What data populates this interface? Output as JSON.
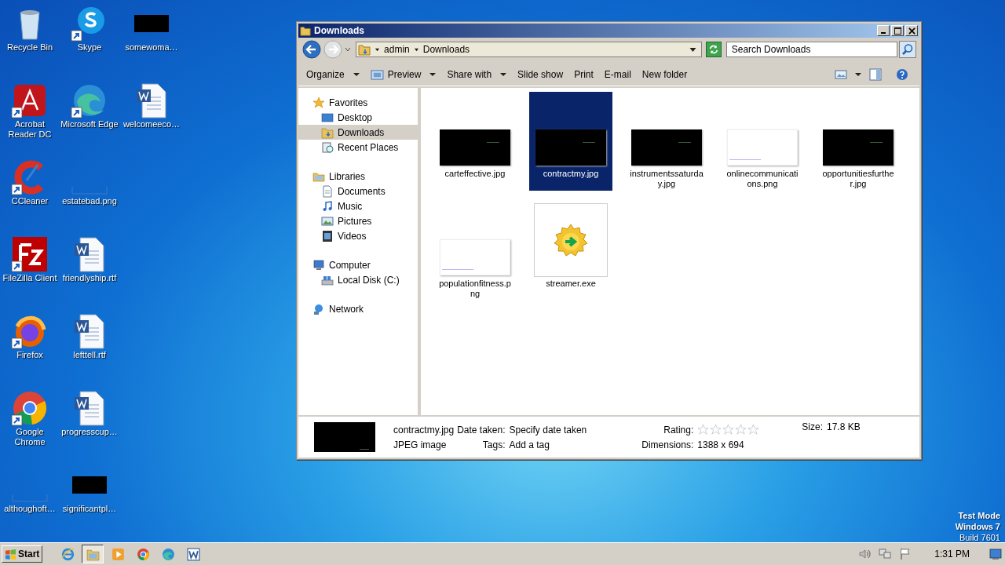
{
  "desktop_icons": [
    [
      {
        "label": "Recycle Bin",
        "kind": "recycle",
        "shortcut": false
      },
      {
        "label": "Skype",
        "kind": "skype",
        "shortcut": true
      },
      {
        "label": "somewoma…",
        "kind": "dark_file"
      }
    ],
    [
      {
        "label": "Acrobat Reader DC",
        "kind": "acrobat",
        "shortcut": true
      },
      {
        "label": "Microsoft Edge",
        "kind": "edge",
        "shortcut": true
      },
      {
        "label": "welcomeeco…",
        "kind": "word",
        "shortcut": false
      }
    ],
    [
      {
        "label": "CCleaner",
        "kind": "ccleaner",
        "shortcut": true
      },
      {
        "label": "estatebad.png",
        "kind": "blank_file"
      }
    ],
    [
      {
        "label": "FileZilla Client",
        "kind": "filezilla",
        "shortcut": true
      },
      {
        "label": "friendlyship.rtf",
        "kind": "word",
        "shortcut": false
      }
    ],
    [
      {
        "label": "Firefox",
        "kind": "firefox",
        "shortcut": true
      },
      {
        "label": "lefttell.rtf",
        "kind": "word",
        "shortcut": false
      }
    ],
    [
      {
        "label": "Google Chrome",
        "kind": "chrome",
        "shortcut": true
      },
      {
        "label": "progresscup…",
        "kind": "word",
        "shortcut": false
      }
    ],
    [
      {
        "label": "althoughoft…",
        "kind": "blank_file"
      },
      {
        "label": "significantpl…",
        "kind": "dark_file"
      }
    ]
  ],
  "window": {
    "title": "Downloads",
    "address": {
      "breadcrumbs": [
        "admin",
        "Downloads"
      ]
    },
    "search": {
      "placeholder": "Search Downloads"
    },
    "toolbar": [
      {
        "label": "Organize",
        "dropdown": true,
        "icon": false
      },
      {
        "label": "Preview",
        "dropdown": true,
        "icon": true
      },
      {
        "label": "Share with",
        "dropdown": true,
        "icon": false
      },
      {
        "label": "Slide show",
        "dropdown": false,
        "icon": false
      },
      {
        "label": "Print",
        "dropdown": false,
        "icon": false
      },
      {
        "label": "E-mail",
        "dropdown": false,
        "icon": false
      },
      {
        "label": "New folder",
        "dropdown": false,
        "icon": false
      }
    ],
    "navigation": [
      {
        "label": "Favorites",
        "kind": "star",
        "selected": false,
        "children": [
          {
            "label": "Desktop",
            "kind": "desktop",
            "selected": false
          },
          {
            "label": "Downloads",
            "kind": "downloads",
            "selected": true
          },
          {
            "label": "Recent Places",
            "kind": "recent",
            "selected": false
          }
        ]
      },
      {
        "label": "Libraries",
        "kind": "library",
        "selected": false,
        "children": [
          {
            "label": "Documents",
            "kind": "documents",
            "selected": false
          },
          {
            "label": "Music",
            "kind": "music",
            "selected": false
          },
          {
            "label": "Pictures",
            "kind": "pictures",
            "selected": false
          },
          {
            "label": "Videos",
            "kind": "videos",
            "selected": false
          }
        ]
      },
      {
        "label": "Computer",
        "kind": "computer",
        "selected": false,
        "children": [
          {
            "label": "Local Disk (C:)",
            "kind": "disk",
            "selected": false
          }
        ]
      },
      {
        "label": "Network",
        "kind": "network",
        "selected": false
      }
    ],
    "files": [
      {
        "name": "carteffective.jpg",
        "kind": "dark_image",
        "selected": false
      },
      {
        "name": "contractmy.jpg",
        "kind": "dark_image",
        "selected": true
      },
      {
        "name": "instrumentssaturday.jpg",
        "kind": "dark_image",
        "selected": false
      },
      {
        "name": "onlinecommunications.png",
        "kind": "light_image",
        "selected": false
      },
      {
        "name": "opportunitiesfurther.jpg",
        "kind": "dark_image",
        "selected": false
      },
      {
        "name": "populationfitness.png",
        "kind": "light_image",
        "selected": false
      },
      {
        "name": "streamer.exe",
        "kind": "program",
        "selected": false
      }
    ],
    "details": {
      "name": "contractmy.jpg",
      "type": "JPEG image",
      "date_label": "Date taken:",
      "date_value": "Specify date taken",
      "tags_label": "Tags:",
      "tags_value": "Add a tag",
      "rating_label": "Rating:",
      "stars": 0,
      "dimensions_label": "Dimensions:",
      "dimensions_value": "1388 x 694",
      "size_label": "Size:",
      "size_value": "17.8 KB"
    }
  },
  "system_notice": [
    {
      "text": "Test Mode",
      "bold": true
    },
    {
      "text": "Windows 7",
      "bold": true
    },
    {
      "text": "Build 7601",
      "bold": false
    }
  ],
  "taskbar": {
    "start": "Start",
    "apps": [
      {
        "kind": "ie",
        "selected": false
      },
      {
        "kind": "explorer",
        "selected": true
      },
      {
        "kind": "media",
        "selected": false
      },
      {
        "kind": "chrome",
        "selected": false
      },
      {
        "kind": "edge",
        "selected": false
      },
      {
        "kind": "word",
        "selected": false
      }
    ],
    "clock": "1:31 PM"
  }
}
